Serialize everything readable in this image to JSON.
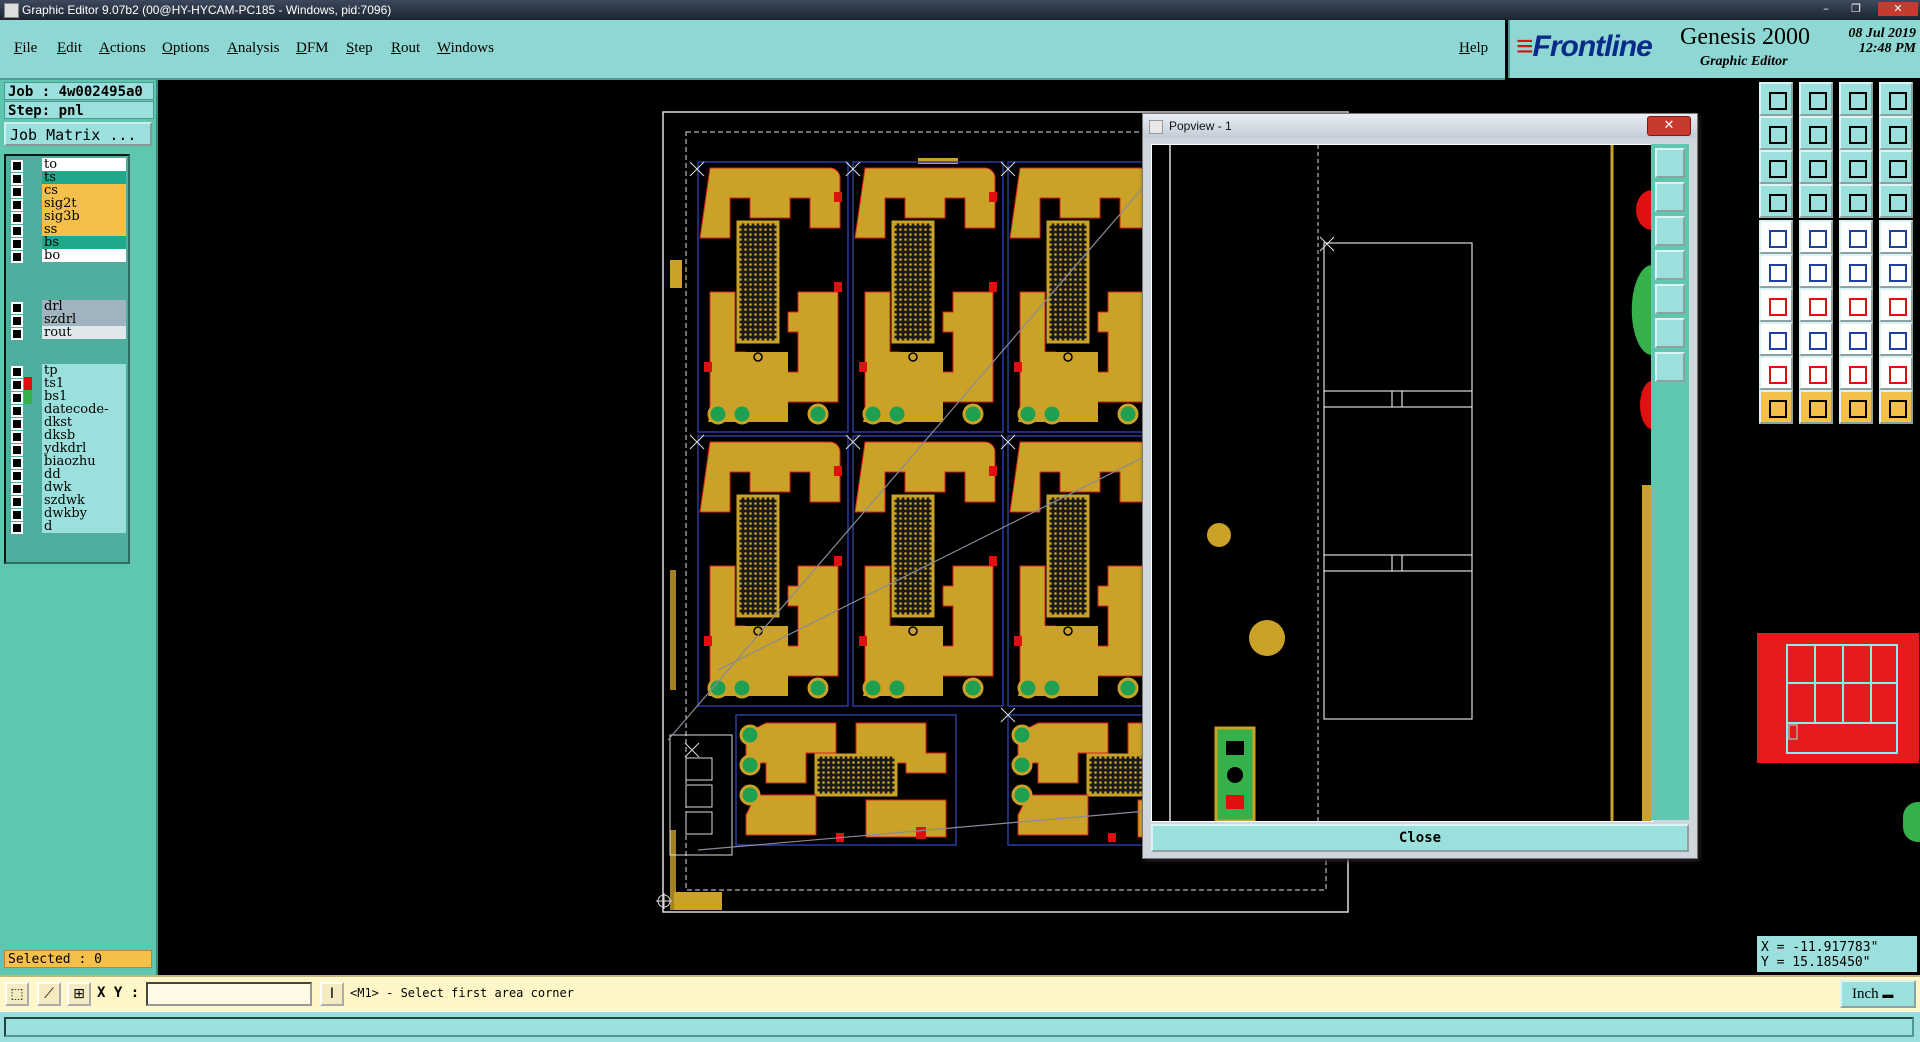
{
  "window": {
    "title": "Graphic Editor 9.07b2 (00@HY-HYCAM-PC185 - Windows, pid:7096)"
  },
  "menu": [
    "File",
    "Edit",
    "Actions",
    "Options",
    "Analysis",
    "DFM",
    "Step",
    "Rout",
    "Windows"
  ],
  "help_label": "Help",
  "brand": {
    "logo": "Frontline",
    "product": "Genesis 2000",
    "subtitle": "Graphic Editor",
    "date": "08 Jul 2019",
    "time": "12:48 PM"
  },
  "job": {
    "job_line": "Job : 4w002495a0",
    "step_line": "Step: pnl",
    "matrix_button": "Job Matrix ..."
  },
  "layers_group1": [
    {
      "name": "to",
      "color": "#ffffff"
    },
    {
      "name": "ts",
      "color": "#1fa98a"
    },
    {
      "name": "cs",
      "color": "#f5c04a"
    },
    {
      "name": "sig2t",
      "color": "#f5c04a"
    },
    {
      "name": "sig3b",
      "color": "#f5c04a"
    },
    {
      "name": "ss",
      "color": "#f5c04a"
    },
    {
      "name": "bs",
      "color": "#1fa98a"
    },
    {
      "name": "bo",
      "color": "#ffffff"
    }
  ],
  "layers_group2": [
    {
      "name": "drl",
      "color": "#9fb4be"
    },
    {
      "name": "szdrl",
      "color": "#9fb4be"
    },
    {
      "name": "rout",
      "color": "#dfe8ea"
    }
  ],
  "layers_group3": [
    {
      "name": "tp",
      "color": "#9be0dc"
    },
    {
      "name": "ts1",
      "color": "#9be0dc"
    },
    {
      "name": "bs1",
      "color": "#9be0dc"
    },
    {
      "name": "datecode-pto",
      "color": "#9be0dc"
    },
    {
      "name": "dkst",
      "color": "#9be0dc"
    },
    {
      "name": "dksb",
      "color": "#9be0dc"
    },
    {
      "name": "ydkdrl",
      "color": "#9be0dc"
    },
    {
      "name": "biaozhu",
      "color": "#9be0dc"
    },
    {
      "name": "dd",
      "color": "#9be0dc"
    },
    {
      "name": "dwk",
      "color": "#9be0dc"
    },
    {
      "name": "szdwk",
      "color": "#9be0dc"
    },
    {
      "name": "dwkby",
      "color": "#9be0dc"
    },
    {
      "name": "d",
      "color": "#9be0dc"
    }
  ],
  "selected": "Selected : 0",
  "popview": {
    "title": "Popview - 1",
    "close_label": "Close"
  },
  "coords": {
    "x": "X = -11.917783\"",
    "y": "Y = 15.185450\""
  },
  "bottom": {
    "xy_label": "X Y :",
    "prompt": "<M1> - Select first area corner",
    "units": "Inch"
  },
  "colors": {
    "panel": "#8fd7d2",
    "copper": "#c9a227",
    "accent_red": "#e01010",
    "mask_green": "#1fa050"
  }
}
